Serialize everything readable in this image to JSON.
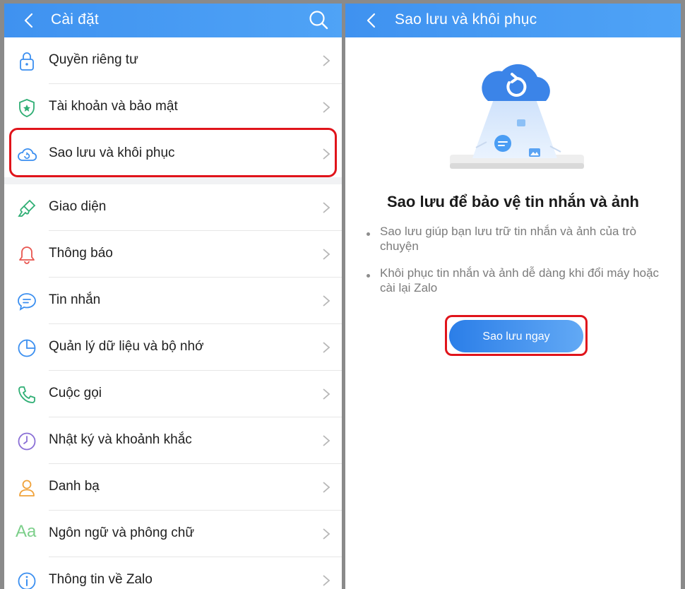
{
  "settings_screen": {
    "title": "Cài đặt",
    "items": [
      {
        "label": "Quyền riêng tư",
        "icon": "lock-icon"
      },
      {
        "label": "Tài khoản và bảo mật",
        "icon": "shield-icon"
      },
      {
        "label": "Sao lưu và khôi phục",
        "icon": "cloud-backup-icon"
      },
      {
        "label": "Giao diện",
        "icon": "paint-brush-icon"
      },
      {
        "label": "Thông báo",
        "icon": "bell-icon"
      },
      {
        "label": "Tin nhắn",
        "icon": "chat-bubble-icon"
      },
      {
        "label": "Quản lý dữ liệu và bộ nhớ",
        "icon": "pie-chart-icon"
      },
      {
        "label": "Cuộc gọi",
        "icon": "phone-icon"
      },
      {
        "label": "Nhật ký và khoảnh khắc",
        "icon": "clock-icon"
      },
      {
        "label": "Danh bạ",
        "icon": "person-icon"
      },
      {
        "label": "Ngôn ngữ và phông chữ",
        "icon": "font-aa-icon",
        "icon_text": "Aa"
      },
      {
        "label": "Thông tin về Zalo",
        "icon": "info-icon"
      }
    ]
  },
  "backup_screen": {
    "title": "Sao lưu và khôi phục",
    "heading": "Sao lưu để bảo vệ tin nhắn và ảnh",
    "bullets": [
      "Sao lưu giúp bạn lưu trữ tin nhắn và ảnh của trò chuyện",
      "Khôi phục tin nhắn và ảnh dễ dàng khi đổi máy hoặc cài lại Zalo"
    ],
    "button_label": "Sao lưu ngay"
  },
  "colors": {
    "header_blue": "#4a9df4",
    "highlight_red": "#e0141b",
    "primary_button": "#3d8ff0"
  }
}
